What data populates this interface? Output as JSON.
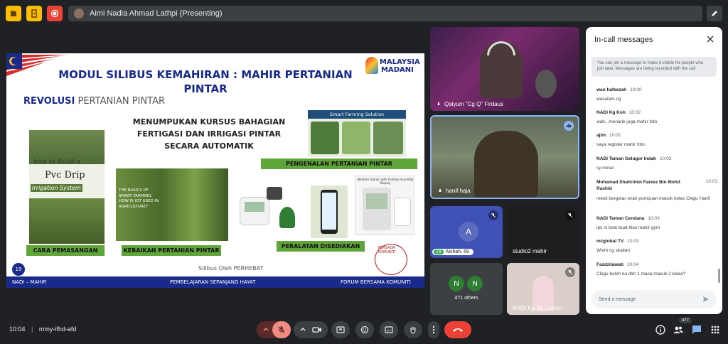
{
  "topbar": {
    "presenting_label": "Aimi Nadia Ahmad Lathpi (Presenting)",
    "icons": [
      "folder-icon",
      "door-icon",
      "record-icon"
    ]
  },
  "slide": {
    "title": "MODUL SILIBUS KEMAHIRAN : MAHIR PERTANIAN PINTAR",
    "brand_top": "MALAYSIA",
    "brand_bottom": "MADANI",
    "subtitle_bold": "REVOLUSI",
    "subtitle_rest": " PERTANIAN PINTAR",
    "heading": "MENUMPUKAN KURSUS BAHAGIAN FERTIGASI DAN IRRIGASI PINTAR SECARA AUTOMATIK",
    "smart_farming_banner": "Smart Farming Solution",
    "pvc_line1": "how to Build a",
    "pvc_line2": "Pvc Drip",
    "pvc_line3": "Irrigation System",
    "basics_text": "THE BASICS OF SMART FARMING: HOW IS IOT USED IN AGRICULTURE?",
    "weather_caption": "Weather Station with Outdoor Humidity Display",
    "label_cara": "CARA PEMASANGAN",
    "label_kebaikan": "KEBAIKAN PERTANIAN PINTAR",
    "label_pengenalan": "PENGENALAN PERTANIAN PINTAR",
    "label_peralatan": "PERALATAN DISEDIAKAN",
    "page_number": "19",
    "credit": "Silibus Oleh PERHEBAT",
    "persada": "PERSADA KOMUNITI",
    "footer_left": "NADI – MAHIR",
    "footer_mid": "PEMBELAJARAN SEPANJANG HAYAT",
    "footer_right": "FORUM BERSAMA KOMUNITI"
  },
  "tiles": {
    "qaiyum": "Qaiyum \"Cg Q\" Firdaus",
    "hanif": "hanif haja",
    "aishah_letter": "A",
    "aishah_count": "19",
    "aishah_name": "Aishah. 69",
    "studio2": "studio2 mahir",
    "others_letter_1": "N",
    "others_letter_2": "N",
    "others_count": "471 others",
    "nadi_kg": "NADI Kg Sg Leman"
  },
  "chat": {
    "title": "In-call messages",
    "info": "You can pin a message to make it visible for people who join later. Messages are being recorded with the call.",
    "messages": [
      {
        "sender": "wan hafeezah",
        "time": "10:00",
        "text": "wasalam cg"
      },
      {
        "sender": "NADI Kg Koh",
        "time": "10:02",
        "text": "wah...menarik juga mahir foto"
      },
      {
        "sender": "ajim",
        "time": "10:02",
        "text": "saya register mahir foto"
      },
      {
        "sender": "NADI Taman Gelugor Indah",
        "time": "10:02",
        "text": "sy minat"
      },
      {
        "sender": "Mohamad Shahrimin Fareez Bin Mohd Rashid",
        "time": "10:03",
        "text": "mesti bergetar ovari pompuan masok kelas Cikgu Hanif"
      },
      {
        "sender": "NADI Taman Cendana",
        "time": "10:03",
        "text": "lps ni bole buat klas mahir gym"
      },
      {
        "sender": "mzglobal TV",
        "time": "10:03",
        "text": "Wslm cg skalian"
      },
      {
        "sender": "Fazdzilawati",
        "time": "10:04",
        "text": "Cikgu boleh ka dlm 1 masa masuk 2 kelas?"
      }
    ],
    "input_placeholder": "Send a message"
  },
  "bottom": {
    "time": "10:04",
    "meeting_code": "mmy-ifhd-afd",
    "participants_badge": "477"
  },
  "colors": {
    "background": "#202124",
    "end_call": "#ea4335",
    "mic_off": "#f28b82",
    "accent_blue": "#8ab4f8",
    "slide_navy": "#1a2a8a",
    "slide_green": "#5fa53a"
  }
}
